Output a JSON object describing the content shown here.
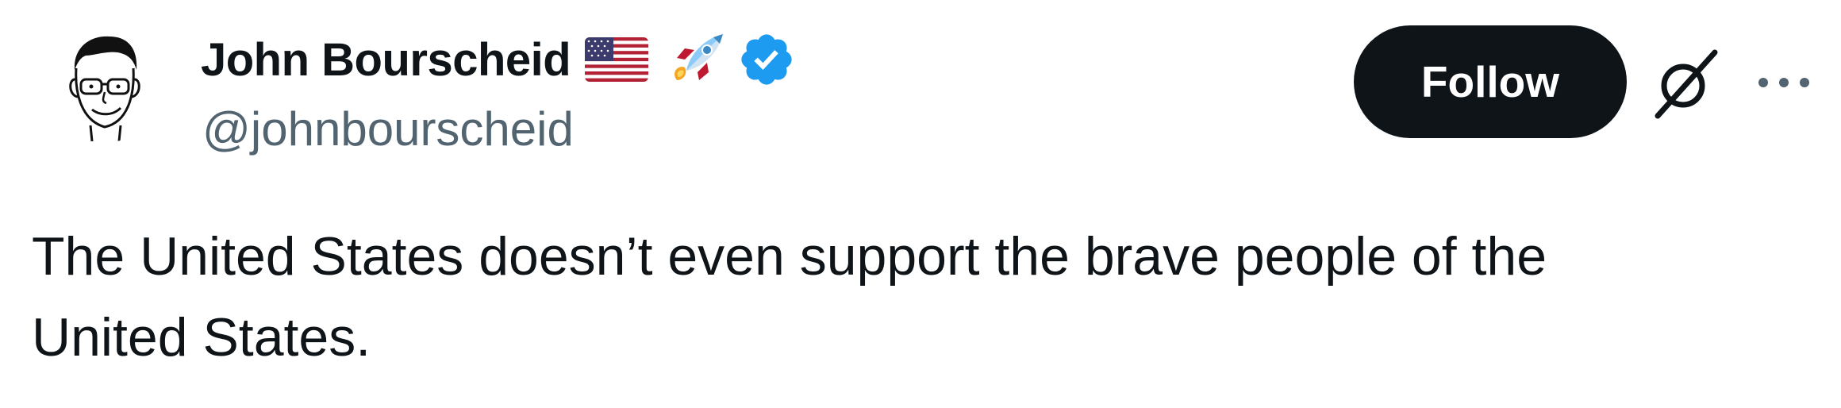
{
  "author": {
    "display_name": "John Bourscheid",
    "handle": "@johnbourscheid",
    "badges": [
      "us-flag-icon",
      "rocket-icon",
      "verified-badge-icon"
    ],
    "verified_color": "#1d9bf0"
  },
  "actions": {
    "follow_label": "Follow",
    "grok_icon": "grok-icon",
    "more_icon": "more-icon"
  },
  "tweet": {
    "text": "The United States doesn’t even support the brave people of the\nUnited States."
  },
  "colors": {
    "text_primary": "#0f1419",
    "text_secondary": "#536471",
    "button_bg": "#0f1419",
    "button_text": "#ffffff"
  }
}
